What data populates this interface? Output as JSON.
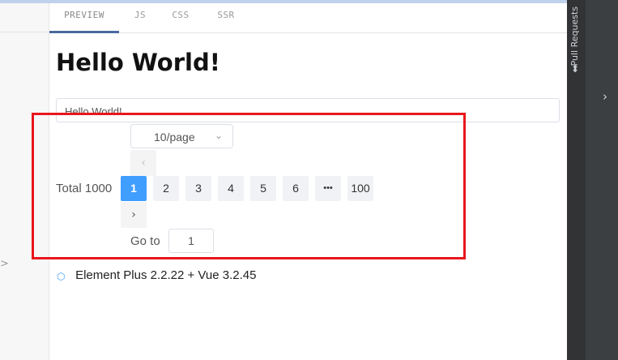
{
  "tabs": [
    "PREVIEW",
    "JS",
    "CSS",
    "SSR"
  ],
  "title": "Hello World!",
  "text_input_value": "Hello World!",
  "page_size": {
    "value": "10/page"
  },
  "pagination": {
    "total": "Total 1000",
    "pages": [
      "1",
      "2",
      "3",
      "4",
      "5",
      "6",
      "•••",
      "100"
    ],
    "current_page": "1",
    "prev_icon": "chevron-left-icon",
    "next_icon": "chevron-right-icon",
    "goto_label": "Go to",
    "goto_value": "1"
  },
  "footer": {
    "text": "Element Plus 2.2.22 + Vue 3.2.45",
    "icon": "element-plus-logo-icon"
  },
  "right_panel": {
    "label": "Pull Requests"
  },
  "colors": {
    "accent": "#409eff",
    "highlight_border": "#e8161b",
    "tab_active_border": "#4a6a9e",
    "dark_panel": "#3c3f41"
  }
}
